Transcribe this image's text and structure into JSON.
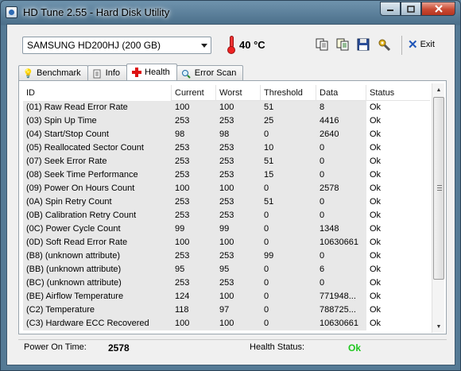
{
  "window": {
    "title": "HD Tune 2.55 - Hard Disk Utility"
  },
  "toolbar": {
    "drive": "SAMSUNG HD200HJ (200 GB)",
    "temperature": "40 °C",
    "exit_label": "Exit"
  },
  "tabs": [
    {
      "label": "Benchmark",
      "icon": "bulb-icon"
    },
    {
      "label": "Info",
      "icon": "info-icon"
    },
    {
      "label": "Health",
      "icon": "health-cross-icon",
      "active": true
    },
    {
      "label": "Error Scan",
      "icon": "magnifier-icon"
    }
  ],
  "table": {
    "headers": [
      "ID",
      "Current",
      "Worst",
      "Threshold",
      "Data",
      "Status"
    ],
    "rows": [
      [
        "(01) Raw Read Error Rate",
        "100",
        "100",
        "51",
        "8",
        "Ok"
      ],
      [
        "(03) Spin Up Time",
        "253",
        "253",
        "25",
        "4416",
        "Ok"
      ],
      [
        "(04) Start/Stop Count",
        "98",
        "98",
        "0",
        "2640",
        "Ok"
      ],
      [
        "(05) Reallocated Sector Count",
        "253",
        "253",
        "10",
        "0",
        "Ok"
      ],
      [
        "(07) Seek Error Rate",
        "253",
        "253",
        "51",
        "0",
        "Ok"
      ],
      [
        "(08) Seek Time Performance",
        "253",
        "253",
        "15",
        "0",
        "Ok"
      ],
      [
        "(09) Power On Hours Count",
        "100",
        "100",
        "0",
        "2578",
        "Ok"
      ],
      [
        "(0A) Spin Retry Count",
        "253",
        "253",
        "51",
        "0",
        "Ok"
      ],
      [
        "(0B) Calibration Retry Count",
        "253",
        "253",
        "0",
        "0",
        "Ok"
      ],
      [
        "(0C) Power Cycle Count",
        "99",
        "99",
        "0",
        "1348",
        "Ok"
      ],
      [
        "(0D) Soft Read Error Rate",
        "100",
        "100",
        "0",
        "10630661",
        "Ok"
      ],
      [
        "(B8) (unknown attribute)",
        "253",
        "253",
        "99",
        "0",
        "Ok"
      ],
      [
        "(BB) (unknown attribute)",
        "95",
        "95",
        "0",
        "6",
        "Ok"
      ],
      [
        "(BC) (unknown attribute)",
        "253",
        "253",
        "0",
        "0",
        "Ok"
      ],
      [
        "(BE) Airflow Temperature",
        "124",
        "100",
        "0",
        "771948...",
        "Ok"
      ],
      [
        "(C2) Temperature",
        "118",
        "97",
        "0",
        "788725...",
        "Ok"
      ],
      [
        "(C3) Hardware ECC Recovered",
        "100",
        "100",
        "0",
        "10630661",
        "Ok"
      ]
    ]
  },
  "footer": {
    "power_on_label": "Power On Time:",
    "power_on_value": "2578",
    "health_label": "Health Status:",
    "health_value": "Ok"
  },
  "colors": {
    "ok": "#1ec71e",
    "close": "#c94a33"
  }
}
